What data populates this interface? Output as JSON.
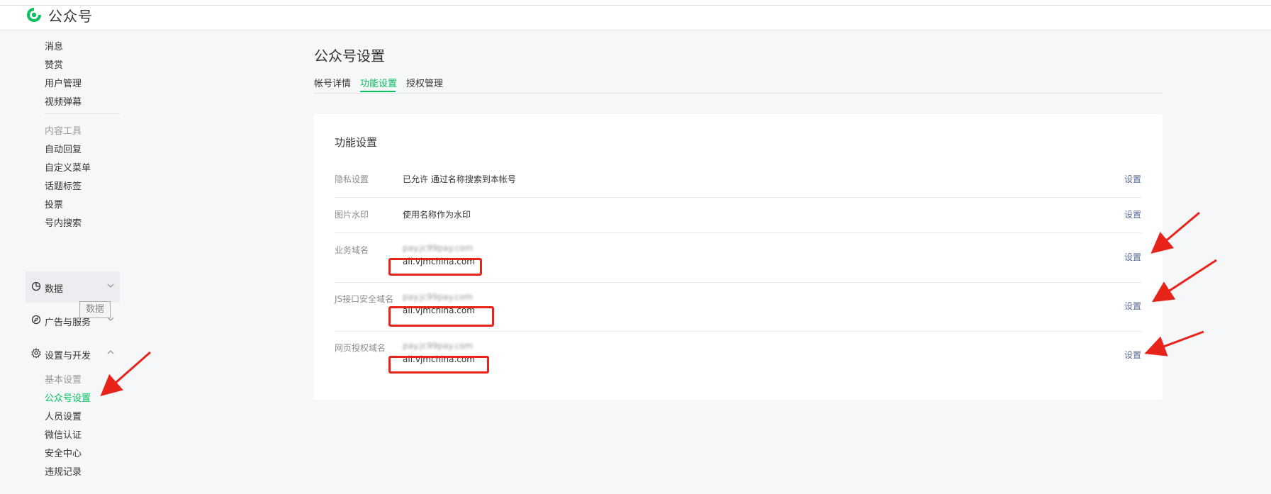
{
  "header": {
    "brand": "公众号",
    "accent": "#07c160"
  },
  "sidebar": {
    "items_top": [
      "消息",
      "赞赏",
      "用户管理",
      "视频弹幕"
    ],
    "content_tools_label": "内容工具",
    "tools": [
      "自动回复",
      "自定义菜单",
      "话题标签",
      "投票",
      "号内搜索"
    ],
    "groups": [
      {
        "label": "数据",
        "icon": "pie-chart-icon",
        "chevron": "chevron-down-icon"
      },
      {
        "label": "广告与服务",
        "icon": "compass-icon",
        "chevron": "chevron-down-icon"
      },
      {
        "label": "设置与开发",
        "icon": "gear-icon",
        "chevron": "chevron-up-icon"
      }
    ],
    "tooltip": "数据",
    "settings_items": [
      "基本设置",
      "公众号设置",
      "人员设置",
      "微信认证",
      "安全中心",
      "违规记录"
    ]
  },
  "main": {
    "title": "公众号设置",
    "tabs": [
      "帐号详情",
      "功能设置",
      "授权管理"
    ],
    "active_tab": "功能设置",
    "card": {
      "title": "功能设置",
      "rows": [
        {
          "label": "隐私设置",
          "value": "已允许 通过名称搜索到本帐号",
          "action": "设置"
        },
        {
          "label": "图片水印",
          "value": "使用名称作为水印",
          "action": "设置"
        },
        {
          "label": "业务域名",
          "value_blurred": "pay.jc99pay.com",
          "value": "all.vjmchina.com",
          "action": "设置"
        },
        {
          "label": "JS接口安全域名",
          "value_blurred": "pay.jc99pay.com",
          "value": "all.vjmchina.com",
          "action": "设置"
        },
        {
          "label": "网页授权域名",
          "value_blurred": "pay.jc99pay.com",
          "value": "all.vjmchina.com",
          "action": "设置"
        }
      ]
    }
  },
  "annotation_color": "#e8231a"
}
